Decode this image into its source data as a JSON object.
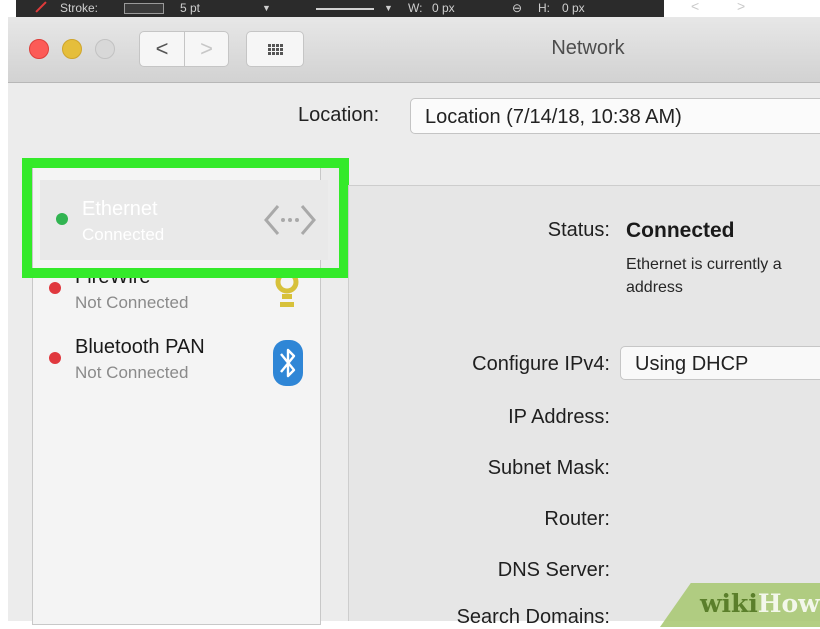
{
  "toolbar_strip": {
    "stroke_label": "Stroke:",
    "stroke_weight": "5 pt",
    "width_label": "W:",
    "width_value": "0 px",
    "height_label": "H:",
    "height_value": "0 px",
    "prev_glyph": "<",
    "next_glyph": ">"
  },
  "window": {
    "title": "Network",
    "back_glyph": "<",
    "forward_glyph": ">"
  },
  "location": {
    "label": "Location:",
    "value": "Location (7/14/18, 10:38 AM)"
  },
  "services": [
    {
      "name": "Ethernet",
      "state": "Connected",
      "status_color": "#31b451",
      "icon": "ethernet-arrows-icon"
    },
    {
      "name": "FireWire",
      "state": "Not Connected",
      "status_color": "#e0383e",
      "icon": "firewire-icon"
    },
    {
      "name": "Bluetooth PAN",
      "state": "Not Connected",
      "status_color": "#e0383e",
      "icon": "bluetooth-icon"
    }
  ],
  "detail": {
    "status_label": "Status:",
    "status_value": "Connected",
    "status_desc_line1": "Ethernet  is currently a",
    "status_desc_line2": "address",
    "configure_label": "Configure IPv4:",
    "configure_value": "Using DHCP",
    "ip_label": "IP Address:",
    "subnet_label": "Subnet Mask:",
    "router_label": "Router:",
    "dns_label": "DNS Server:",
    "search_label": "Search Domains:"
  },
  "watermark": {
    "part1": "wiki",
    "part2": "How"
  },
  "colors": {
    "highlight": "#34ea2a",
    "connected": "#31b451",
    "not_connected": "#e0383e"
  }
}
